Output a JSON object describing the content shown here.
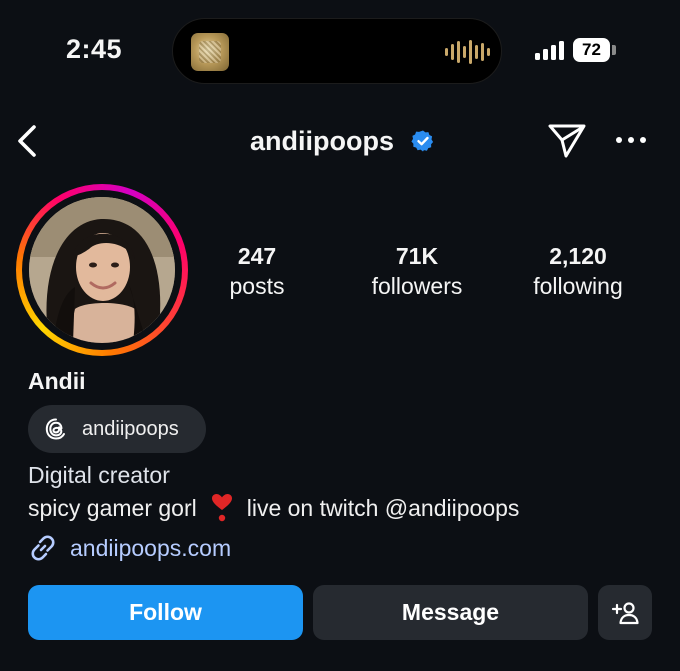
{
  "status_bar": {
    "time": "2:45",
    "battery": "72",
    "accent_audio": "#c9a86a"
  },
  "nav": {
    "username": "andiipoops",
    "back_icon": "chevron-left-icon",
    "verified_icon": "verified-badge-icon",
    "send_icon": "paper-plane-icon",
    "more_icon": "ellipsis-icon"
  },
  "profile": {
    "stats": [
      {
        "value": "247",
        "label": "posts"
      },
      {
        "value": "71K",
        "label": "followers"
      },
      {
        "value": "2,120",
        "label": "following"
      }
    ],
    "display_name": "Andii",
    "threads_handle": "andiipoops",
    "category": "Digital creator",
    "bio_before": "spicy gamer gorl",
    "bio_after": "live on twitch @andiipoops",
    "link": "andiipoops.com"
  },
  "actions": {
    "follow": "Follow",
    "message": "Message",
    "suggest_icon": "add-person-icon"
  },
  "colors": {
    "background": "#0c0f14",
    "follow_button": "#1c95f2",
    "secondary_button": "#262a30",
    "link": "#b6ccff",
    "verified": "#2a8cf0"
  }
}
